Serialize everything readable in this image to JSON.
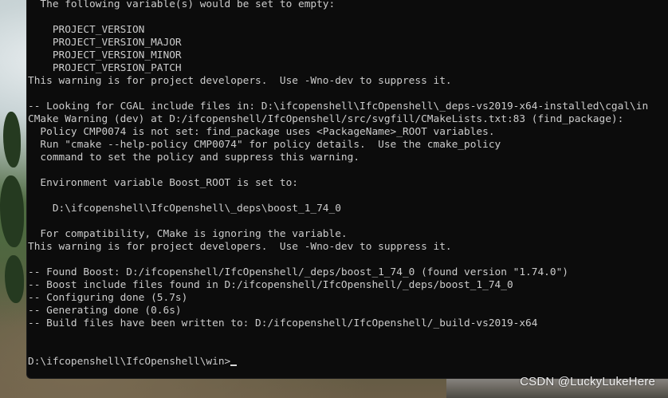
{
  "terminal": {
    "lines": [
      "  The following variable(s) would be set to empty:",
      "",
      "    PROJECT_VERSION",
      "    PROJECT_VERSION_MAJOR",
      "    PROJECT_VERSION_MINOR",
      "    PROJECT_VERSION_PATCH",
      "This warning is for project developers.  Use -Wno-dev to suppress it.",
      "",
      "-- Looking for CGAL include files in: D:\\ifcopenshell\\IfcOpenshell\\_deps-vs2019-x64-installed\\cgal\\in",
      "CMake Warning (dev) at D:/ifcopenshell/IfcOpenshell/src/svgfill/CMakeLists.txt:83 (find_package):",
      "  Policy CMP0074 is not set: find_package uses <PackageName>_ROOT variables.",
      "  Run \"cmake --help-policy CMP0074\" for policy details.  Use the cmake_policy",
      "  command to set the policy and suppress this warning.",
      "",
      "  Environment variable Boost_ROOT is set to:",
      "",
      "    D:\\ifcopenshell\\IfcOpenshell\\_deps\\boost_1_74_0",
      "",
      "  For compatibility, CMake is ignoring the variable.",
      "This warning is for project developers.  Use -Wno-dev to suppress it.",
      "",
      "-- Found Boost: D:/ifcopenshell/IfcOpenshell/_deps/boost_1_74_0 (found version \"1.74.0\")",
      "-- Boost include files found in D:/ifcopenshell/IfcOpenshell/_deps/boost_1_74_0",
      "-- Configuring done (5.7s)",
      "-- Generating done (0.6s)",
      "-- Build files have been written to: D:/ifcopenshell/IfcOpenshell/_build-vs2019-x64",
      "",
      ""
    ],
    "prompt": "D:\\ifcopenshell\\IfcOpenshell\\win>"
  },
  "watermark": "CSDN @LuckyLukeHere"
}
